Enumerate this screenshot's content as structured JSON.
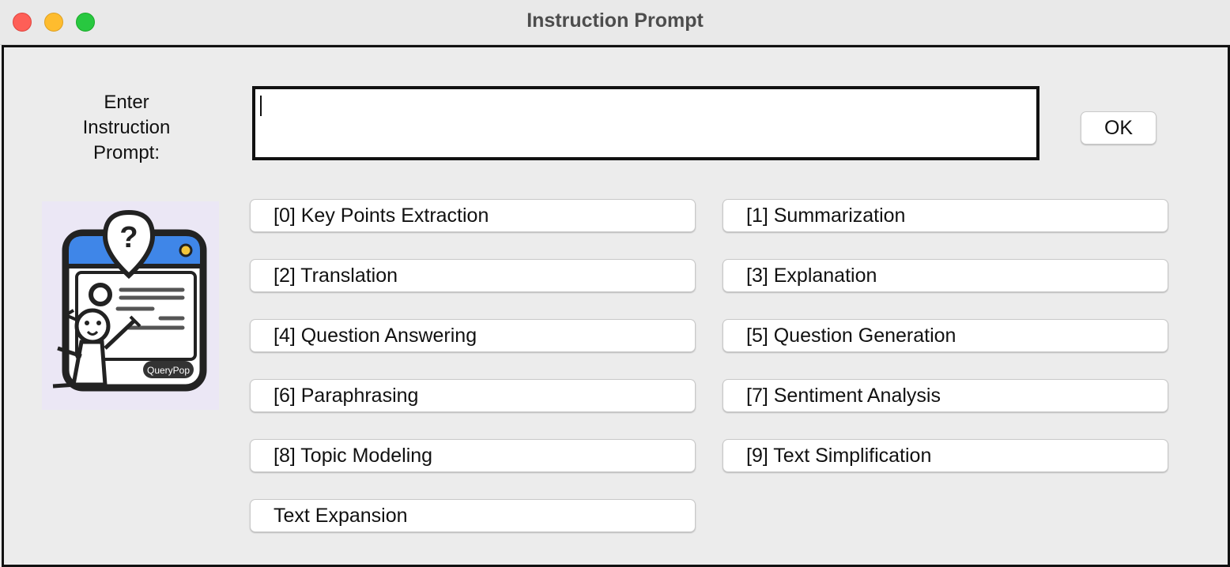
{
  "window": {
    "title": "Instruction Prompt"
  },
  "prompt": {
    "label_lines": [
      "Enter",
      "Instruction",
      "Prompt:"
    ],
    "value": "",
    "ok_label": "OK"
  },
  "logo": {
    "brand_text": "QueryPop"
  },
  "options": [
    "[0] Key Points Extraction",
    "[1] Summarization",
    "[2] Translation",
    "[3] Explanation",
    "[4] Question Answering",
    "[5] Question Generation",
    "[6] Paraphrasing",
    "[7] Sentiment Analysis",
    "[8] Topic Modeling",
    "[9] Text Simplification",
    "Text Expansion"
  ],
  "colors": {
    "close": "#fe5f57",
    "minimize": "#febc2e",
    "maximize": "#28c840",
    "logo_blue": "#3f86e8"
  }
}
